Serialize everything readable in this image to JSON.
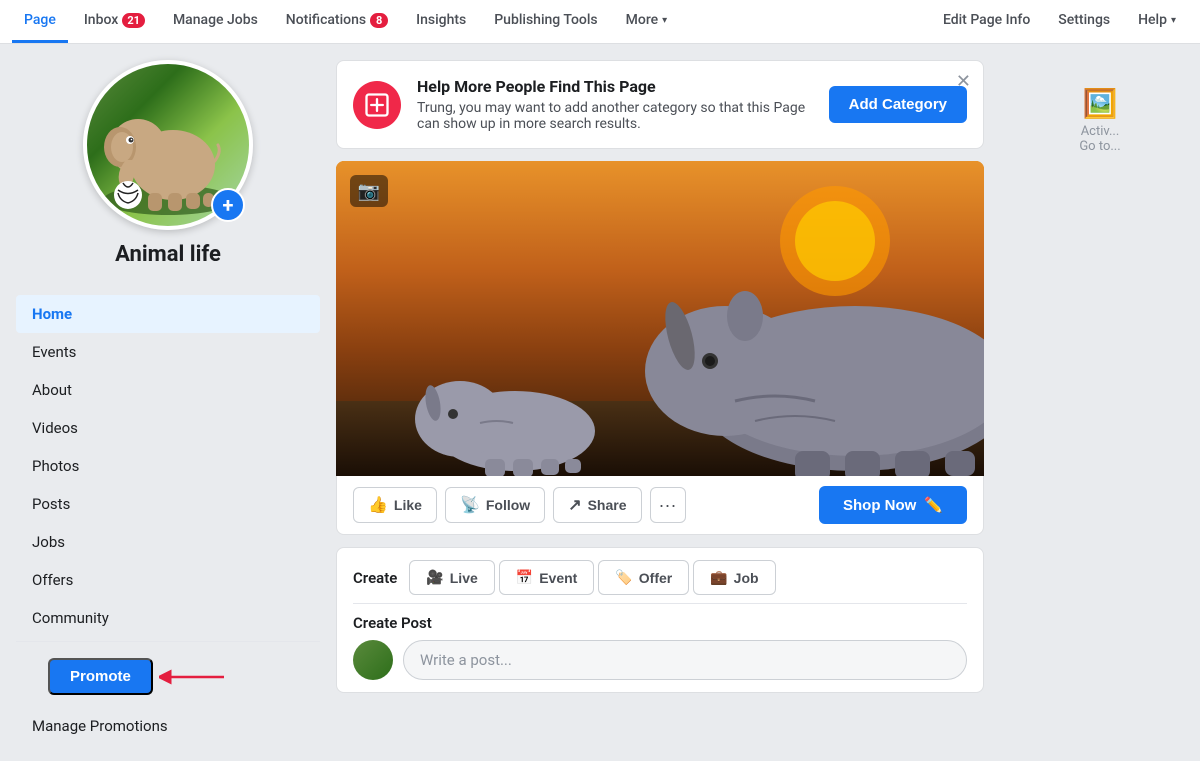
{
  "nav": {
    "items": [
      {
        "id": "page",
        "label": "Page",
        "active": true,
        "badge": null
      },
      {
        "id": "inbox",
        "label": "Inbox",
        "active": false,
        "badge": "21"
      },
      {
        "id": "manage-jobs",
        "label": "Manage Jobs",
        "active": false,
        "badge": null
      },
      {
        "id": "notifications",
        "label": "Notifications",
        "active": false,
        "badge": "8"
      },
      {
        "id": "insights",
        "label": "Insights",
        "active": false,
        "badge": null
      },
      {
        "id": "publishing-tools",
        "label": "Publishing Tools",
        "active": false,
        "badge": null
      },
      {
        "id": "more",
        "label": "More",
        "active": false,
        "badge": null,
        "dropdown": true
      },
      {
        "id": "edit-page-info",
        "label": "Edit Page Info",
        "active": false,
        "badge": null
      },
      {
        "id": "settings",
        "label": "Settings",
        "active": false,
        "badge": null
      },
      {
        "id": "help",
        "label": "Help",
        "active": false,
        "badge": null,
        "dropdown": true
      }
    ]
  },
  "sidebar": {
    "page_name": "Animal life",
    "nav_items": [
      {
        "id": "home",
        "label": "Home",
        "active": true
      },
      {
        "id": "events",
        "label": "Events",
        "active": false
      },
      {
        "id": "about",
        "label": "About",
        "active": false
      },
      {
        "id": "videos",
        "label": "Videos",
        "active": false
      },
      {
        "id": "photos",
        "label": "Photos",
        "active": false
      },
      {
        "id": "posts",
        "label": "Posts",
        "active": false
      },
      {
        "id": "jobs",
        "label": "Jobs",
        "active": false
      },
      {
        "id": "offers",
        "label": "Offers",
        "active": false
      },
      {
        "id": "community",
        "label": "Community",
        "active": false
      }
    ],
    "promote_label": "Promote",
    "manage_promotions_label": "Manage Promotions"
  },
  "notification_banner": {
    "title": "Help More People Find This Page",
    "description": "Trung, you may want to add another category so that this Page can show up in more search results.",
    "button_label": "Add Category"
  },
  "action_bar": {
    "like_label": "Like",
    "follow_label": "Follow",
    "share_label": "Share",
    "shop_now_label": "Shop Now"
  },
  "create_row": {
    "create_label": "Create",
    "live_label": "Live",
    "event_label": "Event",
    "offer_label": "Offer",
    "job_label": "Job",
    "post_section_label": "Create Post",
    "post_placeholder": "Write a post..."
  },
  "right_sidebar": {
    "icon": "🖼",
    "label": "Activ..."
  }
}
